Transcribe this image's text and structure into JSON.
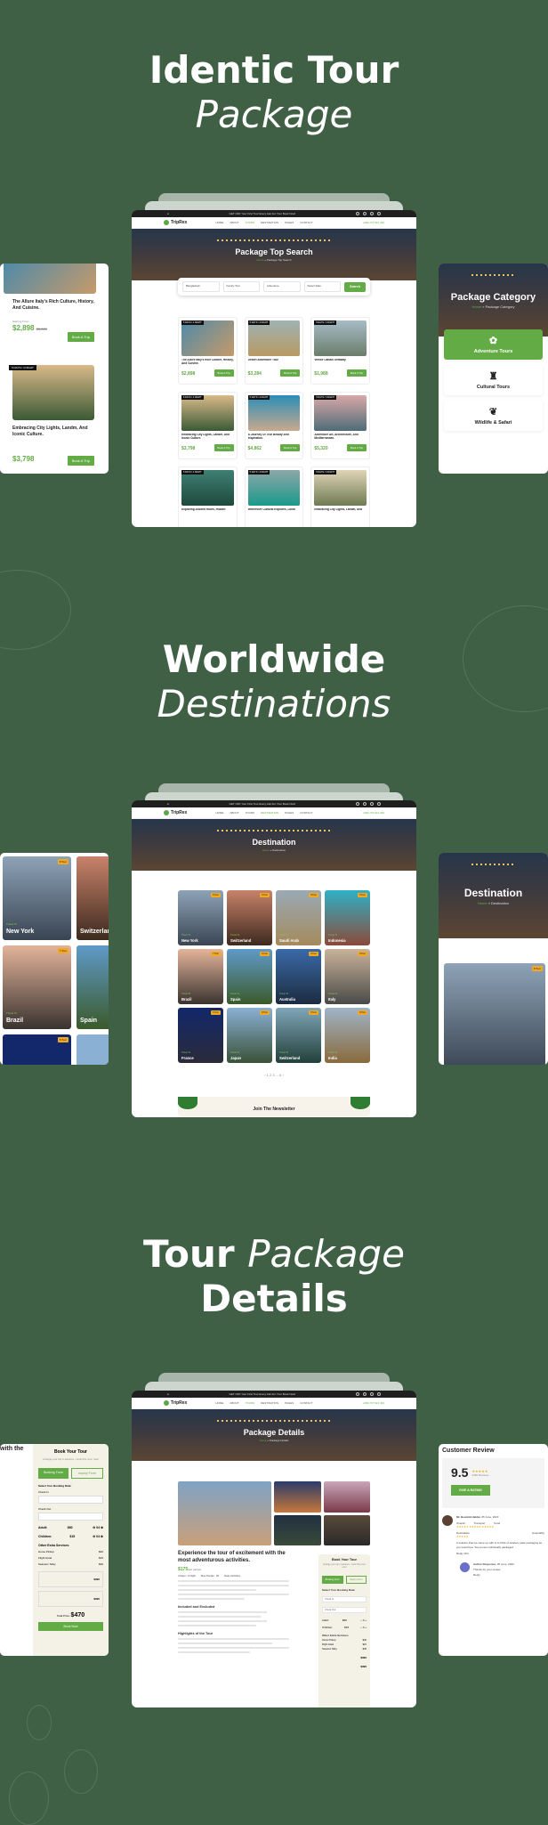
{
  "sections": [
    {
      "title_plain": "Identic Tour",
      "title_italic": "Package"
    },
    {
      "title_plain": "Worldwide",
      "title_italic": "Destinations"
    },
    {
      "title_plain_prefix": "Tour",
      "title_italic": "Package",
      "title_plain_suffix": "Details"
    }
  ],
  "site": {
    "logo": "TripRex",
    "topbar_notice": "GET OFF Your First Tour Every Ask For Your Book Now!",
    "menu": [
      "HOME",
      "ABOUT",
      "TOURS",
      "DESTINATION",
      "PAGES",
      "CONTACT"
    ],
    "contact_label": "To More Inquiry",
    "contact_phone": "+990-737 621 432",
    "colors": {
      "brand_green": "#63ab45",
      "background": "#3f6045",
      "badge_orange": "#f2a922"
    }
  },
  "package_search": {
    "hero_title": "Package Top Search",
    "crumb_home": "Home",
    "crumb_current": "Package Top Search",
    "fields": [
      {
        "label": "Destination",
        "value": "Bangladesh"
      },
      {
        "label": "Tour Type",
        "value": "Family Tour"
      },
      {
        "label": "Tour Category",
        "value": "Adventure"
      },
      {
        "label": "Guest",
        "value": "Select Date"
      }
    ],
    "search_button": "Search",
    "cards": [
      {
        "tag": "5 DAYS / 4 NIGHT",
        "title": "The Allure Italy's Rich Culture, History, And Cuisine.",
        "price": "$2,898",
        "old_price": "$3,600",
        "book": "Book A Trip"
      },
      {
        "tag": "5 DAYS / 4 NIGHT",
        "title": "Desert Adventure Tour",
        "price": "$3,284",
        "old_price": "",
        "book": "Book A Trip"
      },
      {
        "tag": "5 DAYS / 4 NIGHT",
        "title": "Venice Canals Getaway",
        "price": "$1,988",
        "old_price": "$2,500",
        "book": "Book A Trip"
      },
      {
        "tag": "5 DAYS / 4 NIGHT",
        "title": "Embracing City Lights, Landm, And Iconic Culture.",
        "price": "$3,798",
        "old_price": "",
        "book": "Book A Trip"
      },
      {
        "tag": "5 DAYS / 4 NIGHT",
        "title": "A Journey Of True Beauty And Inspiration.",
        "price": "$4,862",
        "old_price": "$5,600",
        "book": "Book A Trip"
      },
      {
        "tag": "5 DAYS / 4 NIGHT",
        "title": "Adventure Art, Architecture, And Mediterranean.",
        "price": "$5,320",
        "old_price": "$6,400",
        "book": "Book A Trip"
      },
      {
        "tag": "5 DAYS / 4 NIGHT",
        "title": "Exploring Ancient Ruins, Hidden",
        "price": "",
        "old_price": "",
        "book": ""
      },
      {
        "tag": "5 DAYS / 4 NIGHT",
        "title": "Immersive Cultural Explores, Local",
        "price": "",
        "old_price": "",
        "book": ""
      },
      {
        "tag": "5 DAYS / 4 NIGHT",
        "title": "Embracing City Lights, Landm, And",
        "price": "",
        "old_price": "",
        "book": ""
      }
    ],
    "side_left": {
      "from_label": "Starting From:",
      "book": "Book A Trip"
    },
    "category_panel": {
      "hero_title": "Package Category",
      "crumb_home": "Home",
      "crumb_current": "Package Category",
      "tiles": [
        "Adventure Tours",
        "Cultural Tours",
        "Wildlife & Safari"
      ]
    }
  },
  "destinations": {
    "hero_title": "Destination",
    "crumb_home": "Home",
    "crumb_current": "Destination",
    "travel_to": "Travel To",
    "items": [
      {
        "name": "New York",
        "tours": "8 Tour"
      },
      {
        "name": "Switzerland",
        "tours": "8 Tour"
      },
      {
        "name": "Saudi Arab",
        "tours": "8 Tour"
      },
      {
        "name": "Indonesia",
        "tours": "8 Tour"
      },
      {
        "name": "Brazil",
        "tours": "7 Tour"
      },
      {
        "name": "Spain",
        "tours": "8 Tour"
      },
      {
        "name": "Australia",
        "tours": "8 Tour"
      },
      {
        "name": "Italy",
        "tours": "8 Tour"
      },
      {
        "name": "France",
        "tours": "8 Tour"
      },
      {
        "name": "Japan",
        "tours": "8 Tour"
      },
      {
        "name": "Switzerland",
        "tours": "8 Tour"
      },
      {
        "name": "India",
        "tours": "8 Tour"
      }
    ],
    "pagination": "1 2 3 ... 6",
    "newsletter": "Join The Newsletter"
  },
  "details": {
    "hero_title": "Package Details",
    "crumb_home": "Home",
    "crumb_current": "Package Details",
    "heading": "Experience the tour of excitement with the most adventurous activities.",
    "price": "$175",
    "price_unit": "/per person",
    "meta": [
      "4 Days / 3 Night",
      "Max People : 30",
      "Daily Activities"
    ],
    "included_heading": "Included and Excluded",
    "highlights_heading": "Highlights of the Tour",
    "booking": {
      "title": "Book Your Tour",
      "subtitle": "Arrange your trip in advance - book this room now!",
      "tab_booking": "Booking Form",
      "tab_inquiry": "Inquiry Form",
      "select_date": "Select Your Booking Date:",
      "check_in": "Check In",
      "check_out": "Check Out",
      "adult_label": "Adult:",
      "adult_price": "$60",
      "children_label": "Children:",
      "children_price": "$15",
      "extras_heading": "Other Extra Services",
      "extras": [
        {
          "name": "Home Pickup",
          "price": "$40"
        },
        {
          "name": "Flight Hotel",
          "price": "$15"
        },
        {
          "name": "Seasons Tafsy",
          "price": "$30"
        }
      ],
      "adult_total": "$390",
      "children_total": "$390",
      "total_label": "Total Price:",
      "total": "$470",
      "book_now": "Book Now"
    },
    "review": {
      "title": "Customer Review",
      "score": "9.5",
      "count": "2390 Reviews",
      "give_rating": "GIVE A RATING",
      "reviewer": "Mr. Bowmik Haldar,",
      "date": "05 June, 2023",
      "categories": [
        "Overall",
        "Transport",
        "Food",
        "Destination",
        "Hospitality"
      ],
      "text": "A solution that we came up with is to think of sanitary pads packaging as you would tea. Tea comes individually packaged",
      "reply": "Reply (02)",
      "author_name": "Author Response,",
      "author_date": "05 June, 2023",
      "author_text": "Thanks for your review.",
      "author_reply": "Reply",
      "next_reviewer": "Saiful Bawnkar,",
      "next_date": "05 June, 2023"
    }
  }
}
